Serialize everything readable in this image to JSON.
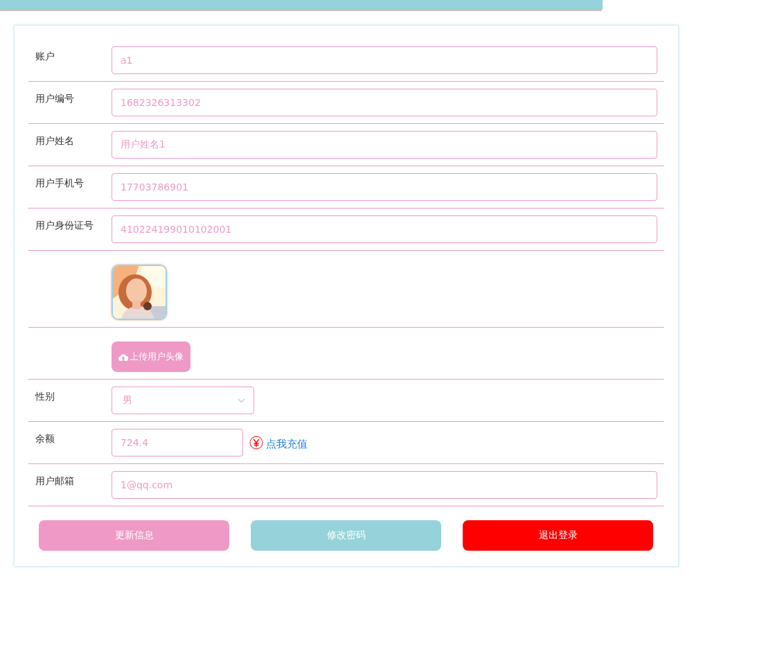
{
  "form": {
    "rows": [
      {
        "kind": "text",
        "label": "账户",
        "value": "a1"
      },
      {
        "kind": "text",
        "label": "用户编号",
        "value": "1682326313302"
      },
      {
        "kind": "text",
        "label": "用户姓名",
        "value": "用户姓名1"
      },
      {
        "kind": "text",
        "label": "用户手机号",
        "value": "17703786901"
      },
      {
        "kind": "text",
        "label": "用户身份证号",
        "value": "410224199010102001"
      },
      {
        "kind": "avatar"
      },
      {
        "kind": "upload",
        "button": "上传用户头像"
      },
      {
        "kind": "select",
        "label": "性别",
        "value": "男"
      },
      {
        "kind": "balance",
        "label": "余额",
        "value": "724.4",
        "link": "点我充值"
      },
      {
        "kind": "text",
        "label": "用户邮箱",
        "value": "1@qq.com"
      }
    ]
  },
  "buttons": [
    {
      "kind": "update",
      "label": "更新信息"
    },
    {
      "kind": "password",
      "label": "修改密码"
    },
    {
      "kind": "logout",
      "label": "退出登录"
    }
  ]
}
